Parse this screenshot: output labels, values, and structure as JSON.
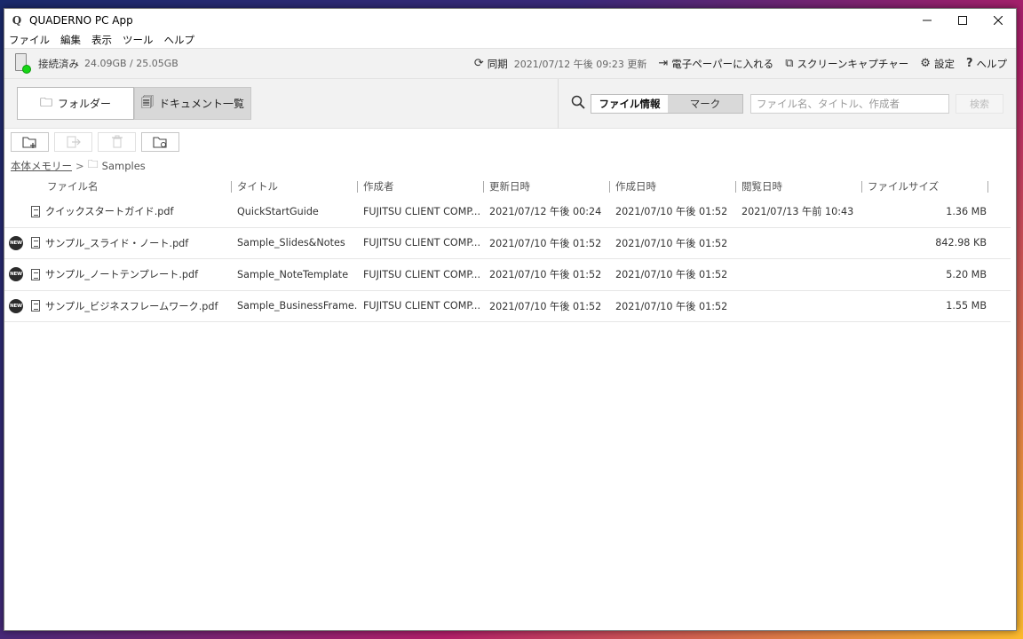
{
  "window": {
    "title": "QUADERNO PC App",
    "logo": "Q",
    "controls": [
      "minimize-icon",
      "maximize-icon",
      "close-icon"
    ]
  },
  "menu": [
    "ファイル",
    "編集",
    "表示",
    "ツール",
    "ヘルプ"
  ],
  "status": {
    "connection": "接続済み",
    "storage": "24.09GB / 25.05GB",
    "sync_label": "同期",
    "sync_time": "2021/07/12 午後 09:23 更新",
    "import_label": "電子ペーパーに入れる",
    "capture_label": "スクリーンキャプチャー",
    "settings_label": "設定",
    "help_label": "ヘルプ",
    "connected_color": "#16d616"
  },
  "tabs": {
    "folder": "フォルダー",
    "documents": "ドキュメント一覧"
  },
  "search": {
    "mode_file_info": "ファイル情報",
    "mode_mark": "マーク",
    "placeholder": "ファイル名、タイトル、作成者",
    "button": "検索"
  },
  "actions": [
    "new-folder-icon",
    "move-out-icon",
    "trash-icon",
    "sync-folder-icon"
  ],
  "breadcrumb": {
    "root": "本体メモリー",
    "sep": ">",
    "folder": "Samples"
  },
  "table": {
    "headers": {
      "name": "ファイル名",
      "title": "タイトル",
      "author": "作成者",
      "updated": "更新日時",
      "created": "作成日時",
      "viewed": "閲覧日時",
      "size": "ファイルサイズ"
    },
    "new_badge": "NEW",
    "rows": [
      {
        "is_new": false,
        "name": "クイックスタートガイド.pdf",
        "title": "QuickStartGuide",
        "author": "FUJITSU CLIENT COMP...",
        "updated": "2021/07/12 午後 00:24",
        "created": "2021/07/10 午後 01:52",
        "viewed": "2021/07/13 午前 10:43",
        "size": "1.36 MB"
      },
      {
        "is_new": true,
        "name": "サンプル_スライド・ノート.pdf",
        "title": "Sample_Slides&Notes",
        "author": "FUJITSU CLIENT COMP...",
        "updated": "2021/07/10 午後 01:52",
        "created": "2021/07/10 午後 01:52",
        "viewed": "",
        "size": "842.98 KB"
      },
      {
        "is_new": true,
        "name": "サンプル_ノートテンプレート.pdf",
        "title": "Sample_NoteTemplate",
        "author": "FUJITSU CLIENT COMP...",
        "updated": "2021/07/10 午後 01:52",
        "created": "2021/07/10 午後 01:52",
        "viewed": "",
        "size": "5.20 MB"
      },
      {
        "is_new": true,
        "name": "サンプル_ビジネスフレームワーク.pdf",
        "title": "Sample_BusinessFrame...",
        "author": "FUJITSU CLIENT COMP...",
        "updated": "2021/07/10 午後 01:52",
        "created": "2021/07/10 午後 01:52",
        "viewed": "",
        "size": "1.55 MB"
      }
    ]
  }
}
